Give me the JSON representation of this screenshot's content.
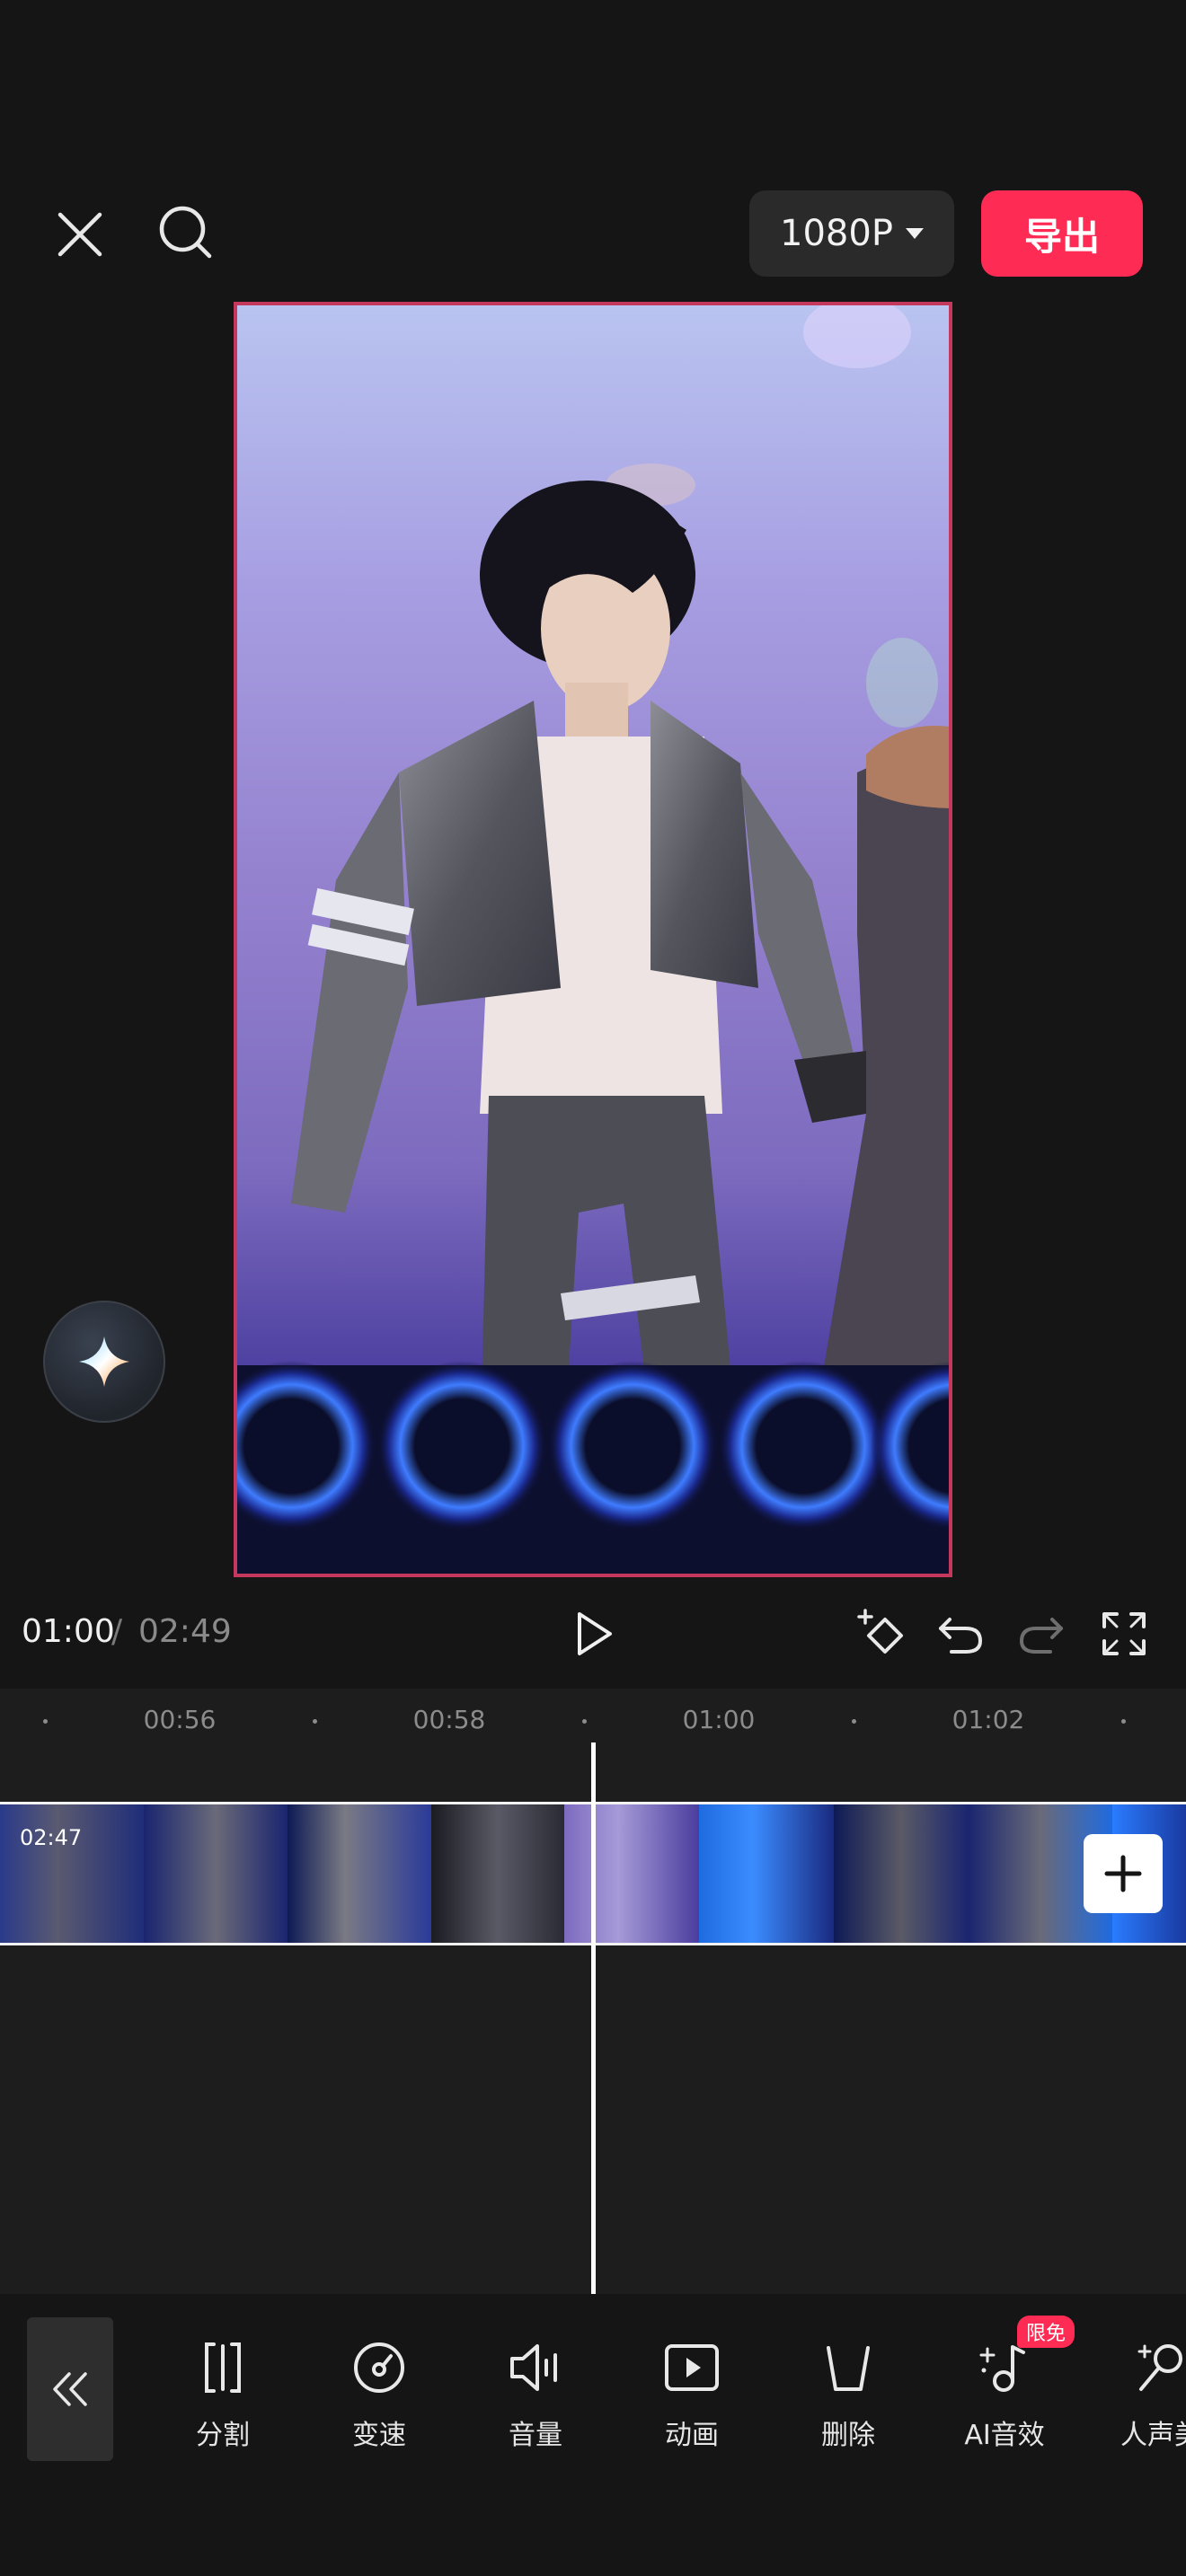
{
  "topbar": {
    "resolution": "1080P",
    "export_label": "导出"
  },
  "playback": {
    "current_time": "01:00",
    "separator": "/",
    "total_time": "02:49"
  },
  "timeline": {
    "ticks": [
      "00:56",
      "00:58",
      "01:00",
      "01:02"
    ],
    "clip_duration": "02:47"
  },
  "toolbar": {
    "items": [
      {
        "label": "分割",
        "icon": "split-icon"
      },
      {
        "label": "变速",
        "icon": "speed-icon"
      },
      {
        "label": "音量",
        "icon": "volume-icon"
      },
      {
        "label": "动画",
        "icon": "animation-icon"
      },
      {
        "label": "删除",
        "icon": "delete-icon"
      },
      {
        "label": "AI音效",
        "icon": "ai-sound-icon"
      },
      {
        "label": "人声美",
        "icon": "voice-beautify-icon"
      }
    ],
    "badge": "限免"
  },
  "colors": {
    "accent": "#fe2c55",
    "background": "#151515",
    "timeline_bg": "#1d1d1d"
  }
}
